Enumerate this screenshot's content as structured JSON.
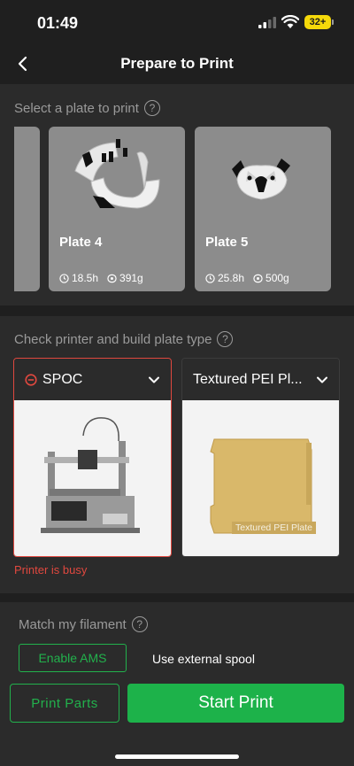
{
  "status_bar": {
    "time": "01:49",
    "battery": "32+"
  },
  "nav": {
    "title": "Prepare to Print"
  },
  "plates_section": {
    "label": "Select a plate to print",
    "plates": [
      {
        "name": "Plate 4",
        "time": "18.5h",
        "weight": "391g"
      },
      {
        "name": "Plate 5",
        "time": "25.8h",
        "weight": "500g"
      }
    ]
  },
  "printer_section": {
    "label": "Check printer and build plate type",
    "printer": {
      "name": "SPOC",
      "status": "Printer is busy"
    },
    "build_plate": {
      "name": "Textured PEI Pl...",
      "image_caption": "Textured PEI Plate"
    }
  },
  "filament_section": {
    "label": "Match my filament",
    "enable_ams": "Enable AMS",
    "external_spool": "Use external spool"
  },
  "actions": {
    "print_parts": "Print Parts",
    "start_print": "Start Print"
  },
  "colors": {
    "accent_green": "#1db24a",
    "error_red": "#e0483f",
    "battery_yellow": "#f5d90a"
  }
}
